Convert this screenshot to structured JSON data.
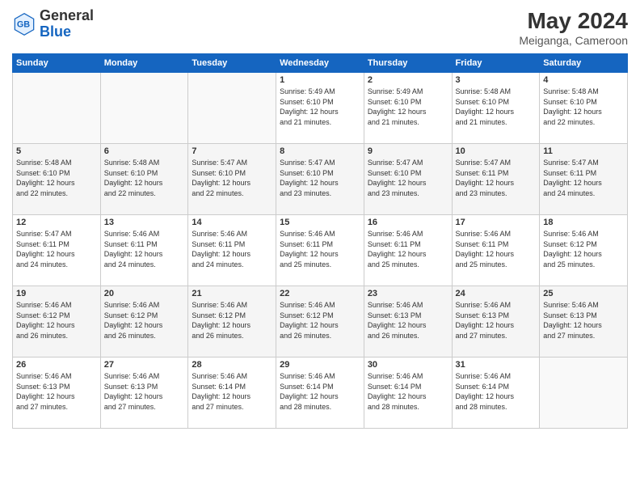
{
  "logo": {
    "general": "General",
    "blue": "Blue"
  },
  "title": {
    "month_year": "May 2024",
    "location": "Meiganga, Cameroon"
  },
  "weekdays": [
    "Sunday",
    "Monday",
    "Tuesday",
    "Wednesday",
    "Thursday",
    "Friday",
    "Saturday"
  ],
  "weeks": [
    [
      {
        "day": "",
        "info": ""
      },
      {
        "day": "",
        "info": ""
      },
      {
        "day": "",
        "info": ""
      },
      {
        "day": "1",
        "info": "Sunrise: 5:49 AM\nSunset: 6:10 PM\nDaylight: 12 hours\nand 21 minutes."
      },
      {
        "day": "2",
        "info": "Sunrise: 5:49 AM\nSunset: 6:10 PM\nDaylight: 12 hours\nand 21 minutes."
      },
      {
        "day": "3",
        "info": "Sunrise: 5:48 AM\nSunset: 6:10 PM\nDaylight: 12 hours\nand 21 minutes."
      },
      {
        "day": "4",
        "info": "Sunrise: 5:48 AM\nSunset: 6:10 PM\nDaylight: 12 hours\nand 22 minutes."
      }
    ],
    [
      {
        "day": "5",
        "info": "Sunrise: 5:48 AM\nSunset: 6:10 PM\nDaylight: 12 hours\nand 22 minutes."
      },
      {
        "day": "6",
        "info": "Sunrise: 5:48 AM\nSunset: 6:10 PM\nDaylight: 12 hours\nand 22 minutes."
      },
      {
        "day": "7",
        "info": "Sunrise: 5:47 AM\nSunset: 6:10 PM\nDaylight: 12 hours\nand 22 minutes."
      },
      {
        "day": "8",
        "info": "Sunrise: 5:47 AM\nSunset: 6:10 PM\nDaylight: 12 hours\nand 23 minutes."
      },
      {
        "day": "9",
        "info": "Sunrise: 5:47 AM\nSunset: 6:10 PM\nDaylight: 12 hours\nand 23 minutes."
      },
      {
        "day": "10",
        "info": "Sunrise: 5:47 AM\nSunset: 6:11 PM\nDaylight: 12 hours\nand 23 minutes."
      },
      {
        "day": "11",
        "info": "Sunrise: 5:47 AM\nSunset: 6:11 PM\nDaylight: 12 hours\nand 24 minutes."
      }
    ],
    [
      {
        "day": "12",
        "info": "Sunrise: 5:47 AM\nSunset: 6:11 PM\nDaylight: 12 hours\nand 24 minutes."
      },
      {
        "day": "13",
        "info": "Sunrise: 5:46 AM\nSunset: 6:11 PM\nDaylight: 12 hours\nand 24 minutes."
      },
      {
        "day": "14",
        "info": "Sunrise: 5:46 AM\nSunset: 6:11 PM\nDaylight: 12 hours\nand 24 minutes."
      },
      {
        "day": "15",
        "info": "Sunrise: 5:46 AM\nSunset: 6:11 PM\nDaylight: 12 hours\nand 25 minutes."
      },
      {
        "day": "16",
        "info": "Sunrise: 5:46 AM\nSunset: 6:11 PM\nDaylight: 12 hours\nand 25 minutes."
      },
      {
        "day": "17",
        "info": "Sunrise: 5:46 AM\nSunset: 6:11 PM\nDaylight: 12 hours\nand 25 minutes."
      },
      {
        "day": "18",
        "info": "Sunrise: 5:46 AM\nSunset: 6:12 PM\nDaylight: 12 hours\nand 25 minutes."
      }
    ],
    [
      {
        "day": "19",
        "info": "Sunrise: 5:46 AM\nSunset: 6:12 PM\nDaylight: 12 hours\nand 26 minutes."
      },
      {
        "day": "20",
        "info": "Sunrise: 5:46 AM\nSunset: 6:12 PM\nDaylight: 12 hours\nand 26 minutes."
      },
      {
        "day": "21",
        "info": "Sunrise: 5:46 AM\nSunset: 6:12 PM\nDaylight: 12 hours\nand 26 minutes."
      },
      {
        "day": "22",
        "info": "Sunrise: 5:46 AM\nSunset: 6:12 PM\nDaylight: 12 hours\nand 26 minutes."
      },
      {
        "day": "23",
        "info": "Sunrise: 5:46 AM\nSunset: 6:13 PM\nDaylight: 12 hours\nand 26 minutes."
      },
      {
        "day": "24",
        "info": "Sunrise: 5:46 AM\nSunset: 6:13 PM\nDaylight: 12 hours\nand 27 minutes."
      },
      {
        "day": "25",
        "info": "Sunrise: 5:46 AM\nSunset: 6:13 PM\nDaylight: 12 hours\nand 27 minutes."
      }
    ],
    [
      {
        "day": "26",
        "info": "Sunrise: 5:46 AM\nSunset: 6:13 PM\nDaylight: 12 hours\nand 27 minutes."
      },
      {
        "day": "27",
        "info": "Sunrise: 5:46 AM\nSunset: 6:13 PM\nDaylight: 12 hours\nand 27 minutes."
      },
      {
        "day": "28",
        "info": "Sunrise: 5:46 AM\nSunset: 6:14 PM\nDaylight: 12 hours\nand 27 minutes."
      },
      {
        "day": "29",
        "info": "Sunrise: 5:46 AM\nSunset: 6:14 PM\nDaylight: 12 hours\nand 28 minutes."
      },
      {
        "day": "30",
        "info": "Sunrise: 5:46 AM\nSunset: 6:14 PM\nDaylight: 12 hours\nand 28 minutes."
      },
      {
        "day": "31",
        "info": "Sunrise: 5:46 AM\nSunset: 6:14 PM\nDaylight: 12 hours\nand 28 minutes."
      },
      {
        "day": "",
        "info": ""
      }
    ]
  ]
}
